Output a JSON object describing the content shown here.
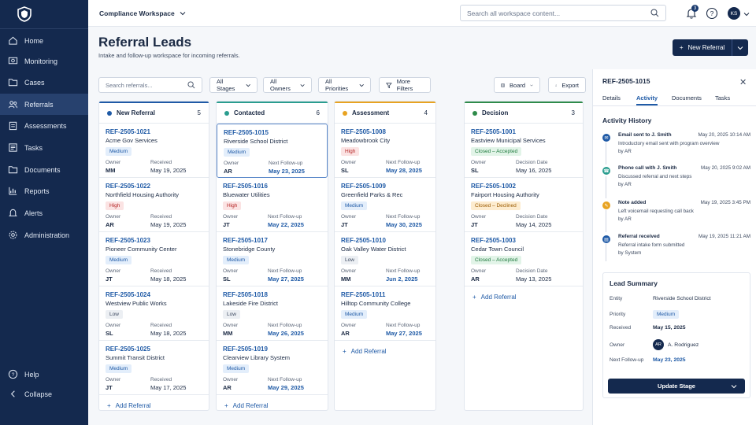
{
  "nav": {
    "items": [
      {
        "label": "Home",
        "icon": "home-icon"
      },
      {
        "label": "Monitoring",
        "icon": "monitor-icon"
      },
      {
        "label": "Cases",
        "icon": "folder-icon"
      },
      {
        "label": "Referrals",
        "icon": "users-icon",
        "active": true
      },
      {
        "label": "Assessments",
        "icon": "clipboard-icon"
      },
      {
        "label": "Tasks",
        "icon": "checklist-icon"
      },
      {
        "label": "Documents",
        "icon": "documents-icon"
      },
      {
        "label": "Reports",
        "icon": "chart-icon"
      },
      {
        "label": "Alerts",
        "icon": "bell-icon"
      },
      {
        "label": "Administration",
        "icon": "gear-icon"
      }
    ],
    "help": "Help",
    "collapse": "Collapse"
  },
  "topbar": {
    "workspace": "Compliance Workspace",
    "search_placeholder": "Search all workspace content...",
    "notifications": "3",
    "user_initials": "KS"
  },
  "page": {
    "title": "Referral Leads",
    "subtitle": "Intake and follow-up workspace for incoming referrals.",
    "new_button": "New Referral"
  },
  "filters": {
    "search_placeholder": "Search referrals...",
    "stages": "All Stages",
    "owners": "All Owners",
    "priorities": "All Priorities",
    "more": "More Filters",
    "board": "Board",
    "export": "Export"
  },
  "columns": [
    {
      "title": "New Referral",
      "count": "5",
      "color": "#1f5aa6",
      "date_label": "Received",
      "cards": [
        {
          "id": "REF-2505-1021",
          "name": "Acme Gov Services",
          "priority": "Medium",
          "owner": "MM",
          "date": "May 19, 2025"
        },
        {
          "id": "REF-2505-1022",
          "name": "Northfield Housing Authority",
          "priority": "High",
          "owner": "AR",
          "date": "May 19, 2025"
        },
        {
          "id": "REF-2505-1023",
          "name": "Pioneer Community Center",
          "priority": "Medium",
          "owner": "JT",
          "date": "May 18, 2025"
        },
        {
          "id": "REF-2505-1024",
          "name": "Westview Public Works",
          "priority": "Low",
          "owner": "SL",
          "date": "May 18, 2025"
        },
        {
          "id": "REF-2505-1025",
          "name": "Summit Transit District",
          "priority": "Medium",
          "owner": "JT",
          "date": "May 17, 2025"
        }
      ],
      "add": "Add Referral"
    },
    {
      "title": "Contacted",
      "count": "6",
      "color": "#2a9d8f",
      "date_label": "Next Follow-up",
      "cards": [
        {
          "id": "REF-2505-1015",
          "name": "Riverside School District",
          "priority": "Medium",
          "owner": "AR",
          "date": "May 23, 2025"
        },
        {
          "id": "REF-2505-1016",
          "name": "Bluewater Utilities",
          "priority": "High",
          "owner": "JT",
          "date": "May 22, 2025"
        },
        {
          "id": "REF-2505-1017",
          "name": "Stonebridge County",
          "priority": "Medium",
          "owner": "SL",
          "date": "May 27, 2025"
        },
        {
          "id": "REF-2505-1018",
          "name": "Lakeside Fire District",
          "priority": "Low",
          "owner": "MM",
          "date": "May 26, 2025"
        },
        {
          "id": "REF-2505-1019",
          "name": "Clearview Library System",
          "priority": "Medium",
          "owner": "AR",
          "date": "May 29, 2025"
        }
      ],
      "add": "Add Referral"
    },
    {
      "title": "Assessment",
      "count": "4",
      "color": "#e8a321",
      "date_label": "Next Follow-up",
      "cards": [
        {
          "id": "REF-2505-1008",
          "name": "Meadowbrook City",
          "priority": "High",
          "owner": "SL",
          "date": "May 28, 2025"
        },
        {
          "id": "REF-2505-1009",
          "name": "Greenfield Parks & Rec",
          "priority": "Medium",
          "owner": "JT",
          "date": "May 30, 2025"
        },
        {
          "id": "REF-2505-1010",
          "name": "Oak Valley Water District",
          "priority": "Low",
          "owner": "MM",
          "date": "Jun 2, 2025"
        },
        {
          "id": "REF-2505-1011",
          "name": "Hilltop Community College",
          "priority": "Medium",
          "owner": "AR",
          "date": "May 27, 2025"
        }
      ],
      "add": "Add Referral"
    },
    {
      "title": "Decision",
      "count": "3",
      "color": "#2e8b4a",
      "date_label": "Decision Date",
      "cards": [
        {
          "id": "REF-2505-1001",
          "name": "Eastview Municipal Services",
          "priority": "Closed – Accepted",
          "owner": "SL",
          "date": "May 16, 2025"
        },
        {
          "id": "REF-2505-1002",
          "name": "Fairport Housing Authority",
          "priority": "Closed – Declined",
          "owner": "JT",
          "date": "May 14, 2025"
        },
        {
          "id": "REF-2505-1003",
          "name": "Cedar Town Council",
          "priority": "Closed – Accepted",
          "owner": "AR",
          "date": "May 13, 2025"
        }
      ],
      "add": "Add Referral"
    }
  ],
  "owner_label": "Owner",
  "panel": {
    "title": "REF-2505-1015",
    "tabs": [
      "Details",
      "Activity",
      "Documents",
      "Tasks"
    ],
    "activity_heading": "Activity History",
    "activities": [
      {
        "title": "Email sent to J. Smith",
        "date": "May 20, 2025 10:14 AM",
        "line1": "Introductory email sent with program overview",
        "line2": "by AR",
        "color": "#1f5aa6"
      },
      {
        "title": "Phone call with J. Smith",
        "date": "May 20, 2025 9:02 AM",
        "line1": "Discussed referral and next steps",
        "line2": "by AR",
        "color": "#2a9d8f"
      },
      {
        "title": "Note added",
        "date": "May 19, 2025 3:45 PM",
        "line1": "Left voicemail requesting call back",
        "line2": "by AR",
        "color": "#e8a321"
      },
      {
        "title": "Referral received",
        "date": "May 19, 2025 11:21 AM",
        "line1": "Referral intake form submitted",
        "line2": "by System",
        "color": "#1f5aa6"
      }
    ],
    "summary": {
      "heading": "Lead Summary",
      "entity_label": "Entity",
      "entity": "Riverside School District",
      "priority_label": "Priority",
      "priority": "Medium",
      "received_label": "Received",
      "received": "May 15, 2025",
      "owner_label": "Owner",
      "owner_initials": "AR",
      "owner": "A. Rodriguez",
      "follow_label": "Next Follow-up",
      "follow": "May 23, 2025",
      "button": "Update Stage"
    }
  }
}
